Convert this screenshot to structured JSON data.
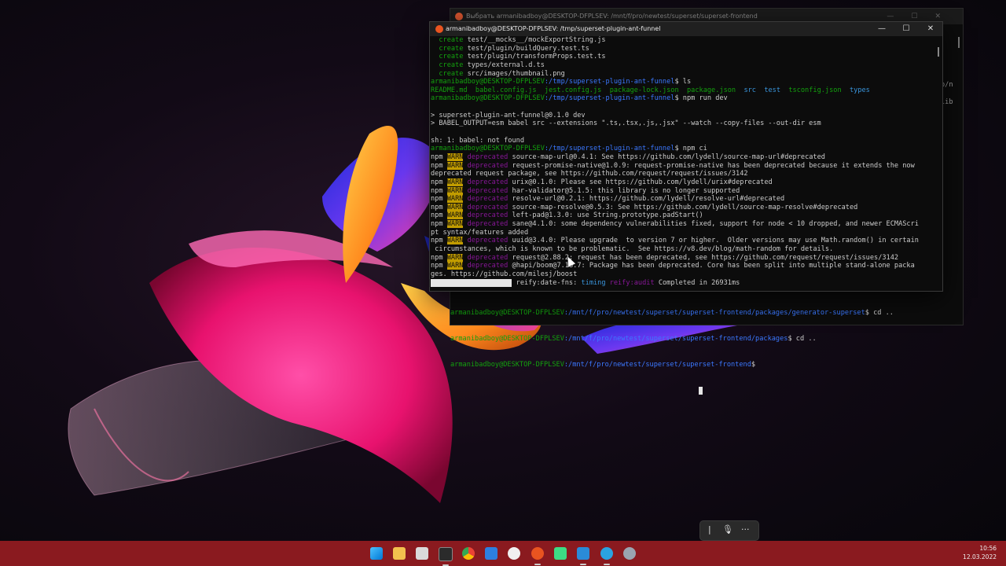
{
  "colors": {
    "terminal_bg": "#0c0c0c",
    "prompt_user": "#13a10e",
    "prompt_path": "#3b78ff",
    "warn_bg": "#c19c00",
    "deprecated": "#881798",
    "taskbar": "#8a1a1f"
  },
  "background_window": {
    "title": "Выбрать armanibadboy@DESKTOP-DFPLSEV: /mnt/f/pro/newtest/superset/superset-frontend",
    "side_fragments": [
      "o/n",
      "lib"
    ],
    "lines": [
      {
        "user": "armanibadboy@DESKTOP-DFPLSEV",
        "path": ":/mnt/f/pro/newtest/superset/superset-frontend/packages/generator-superset",
        "cmd": "$ cd .."
      },
      {
        "user": "armanibadboy@DESKTOP-DFPLSEV",
        "path": ":/mnt/f/pro/newtest/superset/superset-frontend/packages",
        "cmd": "$ cd .."
      },
      {
        "user": "armanibadboy@DESKTOP-DFPLSEV",
        "path": ":/mnt/f/pro/newtest/superset/superset-frontend",
        "cmd": "$ "
      }
    ]
  },
  "terminal": {
    "title": "armanibadboy@DESKTOP-DFPLSEV: /tmp/superset-plugin-ant-funnel",
    "create_lines": [
      {
        "word": "create",
        "file": "test/__mocks__/mockExportString.js"
      },
      {
        "word": "create",
        "file": "test/plugin/buildQuery.test.ts"
      },
      {
        "word": "create",
        "file": "test/plugin/transformProps.test.ts"
      },
      {
        "word": "create",
        "file": "types/external.d.ts"
      },
      {
        "word": "create",
        "file": "src/images/thumbnail.png"
      }
    ],
    "prompt1": {
      "user": "armanibadboy@DESKTOP-DFPLSEV",
      "path": ":/tmp/superset-plugin-ant-funnel",
      "cmd": "$ ls"
    },
    "ls_output": {
      "files": [
        "README.md",
        "babel.config.js",
        "jest.config.js",
        "package-lock.json",
        "package.json"
      ],
      "dirs": [
        "src",
        "test",
        "tsconfig.json",
        "types"
      ]
    },
    "prompt2": {
      "user": "armanibadboy@DESKTOP-DFPLSEV",
      "path": ":/tmp/superset-plugin-ant-funnel",
      "cmd": "$ npm run dev"
    },
    "run_lines": [
      "> superset-plugin-ant-funnel@0.1.0 dev",
      "> BABEL_OUTPUT=esm babel src --extensions \".ts,.tsx,.js,.jsx\" --watch --copy-files --out-dir esm",
      "",
      "sh: 1: babel: not found"
    ],
    "prompt3": {
      "user": "armanibadboy@DESKTOP-DFPLSEV",
      "path": ":/tmp/superset-plugin-ant-funnel",
      "cmd": "$ npm ci"
    },
    "warn_lines": [
      {
        "npm": "npm",
        "warn": "WARN",
        "dep": "deprecated",
        "msg": "source-map-url@0.4.1: See https://github.com/lydell/source-map-url#deprecated"
      },
      {
        "npm": "npm",
        "warn": "WARN",
        "dep": "deprecated",
        "msg": "request-promise-native@1.0.9: request-promise-native has been deprecated because it extends the now"
      },
      {
        "npm": "",
        "warn": "",
        "dep": "",
        "msg": "deprecated request package, see https://github.com/request/request/issues/3142"
      },
      {
        "npm": "npm",
        "warn": "WARN",
        "dep": "deprecated",
        "msg": "urix@0.1.0: Please see https://github.com/lydell/urix#deprecated"
      },
      {
        "npm": "npm",
        "warn": "WARN",
        "dep": "deprecated",
        "msg": "har-validator@5.1.5: this library is no longer supported"
      },
      {
        "npm": "npm",
        "warn": "WARN",
        "dep": "deprecated",
        "msg": "resolve-url@0.2.1: https://github.com/lydell/resolve-url#deprecated"
      },
      {
        "npm": "npm",
        "warn": "WARN",
        "dep": "deprecated",
        "msg": "source-map-resolve@0.5.3: See https://github.com/lydell/source-map-resolve#deprecated"
      },
      {
        "npm": "npm",
        "warn": "WARN",
        "dep": "deprecated",
        "msg": "left-pad@1.3.0: use String.prototype.padStart()"
      },
      {
        "npm": "npm",
        "warn": "WARN",
        "dep": "deprecated",
        "msg": "sane@4.1.0: some dependency vulnerabilities fixed, support for node < 10 dropped, and newer ECMAScri"
      },
      {
        "npm": "",
        "warn": "",
        "dep": "",
        "msg": "pt syntax/features added"
      },
      {
        "npm": "npm",
        "warn": "WARN",
        "dep": "deprecated",
        "msg": "uuid@3.4.0: Please upgrade  to version 7 or higher.  Older versions may use Math.random() in certain"
      },
      {
        "npm": "",
        "warn": "",
        "dep": "",
        "msg": " circumstances, which is known to be problematic.  See https://v8.dev/blog/math-random for details."
      },
      {
        "npm": "npm",
        "warn": "WARN",
        "dep": "deprecated",
        "msg": "request@2.88.2: request has been deprecated, see https://github.com/request/request/issues/3142"
      },
      {
        "npm": "npm",
        "warn": "WARN",
        "dep": "deprecated",
        "msg": "@hapi/boom@7.18.7: Package has been deprecated. Core has been split into multiple stand-alone packa"
      },
      {
        "npm": "",
        "warn": "",
        "dep": "",
        "msg": "ges. https://github.com/milesj/boost"
      }
    ],
    "progress_line": {
      "pkg": "reify:date-fns:",
      "timing": "timing",
      "audit": "reify:audit",
      "msg": "Completed in 26931ms"
    }
  },
  "mini_toolbar": {
    "icons": [
      "cursor-icon",
      "microphone-icon",
      "more-icon"
    ],
    "more": "···"
  },
  "taskbar": {
    "icons": [
      "start-icon",
      "file-explorer-icon",
      "store-icon",
      "terminal-icon",
      "chrome-icon",
      "security-icon",
      "yandex-icon",
      "ubuntu-icon",
      "android-icon",
      "vscode-icon",
      "telegram-icon",
      "settings-icon"
    ],
    "time": "10:56",
    "date": "12.03.2022"
  }
}
